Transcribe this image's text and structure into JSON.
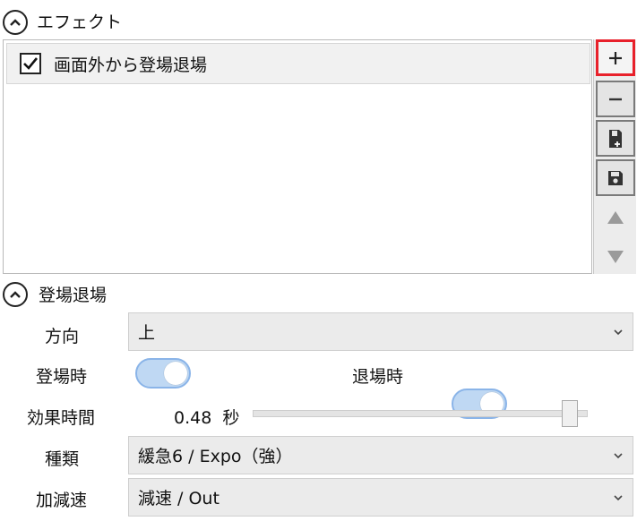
{
  "effects_section": {
    "title": "エフェクト",
    "items": [
      {
        "label": "画面外から登場退場",
        "checked": true
      }
    ],
    "side_buttons": {
      "add": "+",
      "remove": "−"
    }
  },
  "appear_exit_section": {
    "title": "登場退場",
    "direction": {
      "label": "方向",
      "value": "上"
    },
    "appear": {
      "label": "登場時",
      "on": true
    },
    "exit": {
      "label": "退場時",
      "on": true
    },
    "duration": {
      "label": "効果時間",
      "value": "0.48",
      "unit": "秒",
      "slider_fraction": 0.97
    },
    "kind": {
      "label": "種類",
      "value": "緩急6 / Expo（強）"
    },
    "easing": {
      "label": "加減速",
      "value": "減速 / Out"
    }
  },
  "colors": {
    "accent_highlight": "#e8212b",
    "toggle_on": "#bfd8f3",
    "toggle_border": "#8ab4e8"
  }
}
